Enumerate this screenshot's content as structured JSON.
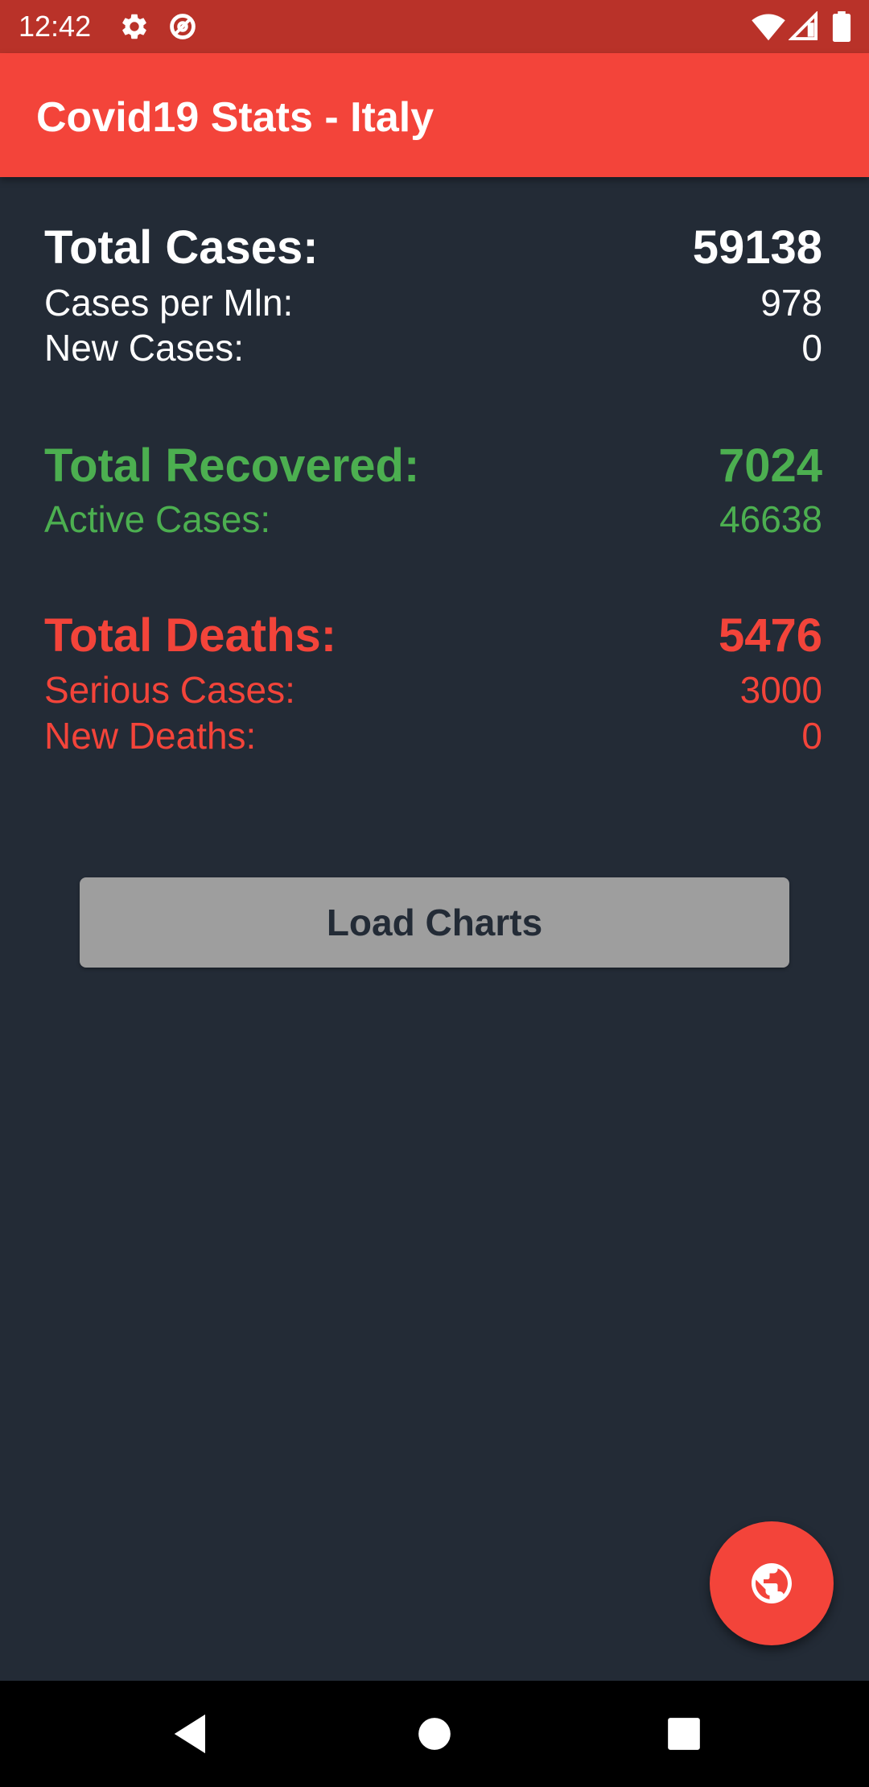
{
  "status_bar": {
    "time": "12:42",
    "icons": [
      "gear-icon",
      "data-saver-icon",
      "wifi-icon",
      "cell-signal-icon",
      "battery-icon"
    ]
  },
  "app_bar": {
    "title": "Covid19 Stats - Italy"
  },
  "stats": {
    "total_cases": {
      "label": "Total Cases:",
      "value": "59138"
    },
    "cases_per_mln": {
      "label": "Cases per Mln:",
      "value": "978"
    },
    "new_cases": {
      "label": "New Cases:",
      "value": "0"
    },
    "total_recovered": {
      "label": "Total Recovered:",
      "value": "7024"
    },
    "active_cases": {
      "label": "Active Cases:",
      "value": "46638"
    },
    "total_deaths": {
      "label": "Total Deaths:",
      "value": "5476"
    },
    "serious_cases": {
      "label": "Serious Cases:",
      "value": "3000"
    },
    "new_deaths": {
      "label": "New Deaths:",
      "value": "0"
    }
  },
  "load_charts_button": {
    "label": "Load Charts"
  },
  "fab": {
    "icon": "globe-icon"
  },
  "nav_bar": {
    "icons": [
      "back-icon",
      "home-icon",
      "recents-icon"
    ]
  },
  "colors": {
    "status_bar": "#b93229",
    "app_bar": "#f3443a",
    "background": "#232b36",
    "text_white": "#ffffff",
    "recovered_green": "#4caf50",
    "deaths_red": "#f3443a",
    "button_gray": "#9e9e9e",
    "nav_bar": "#000000"
  }
}
